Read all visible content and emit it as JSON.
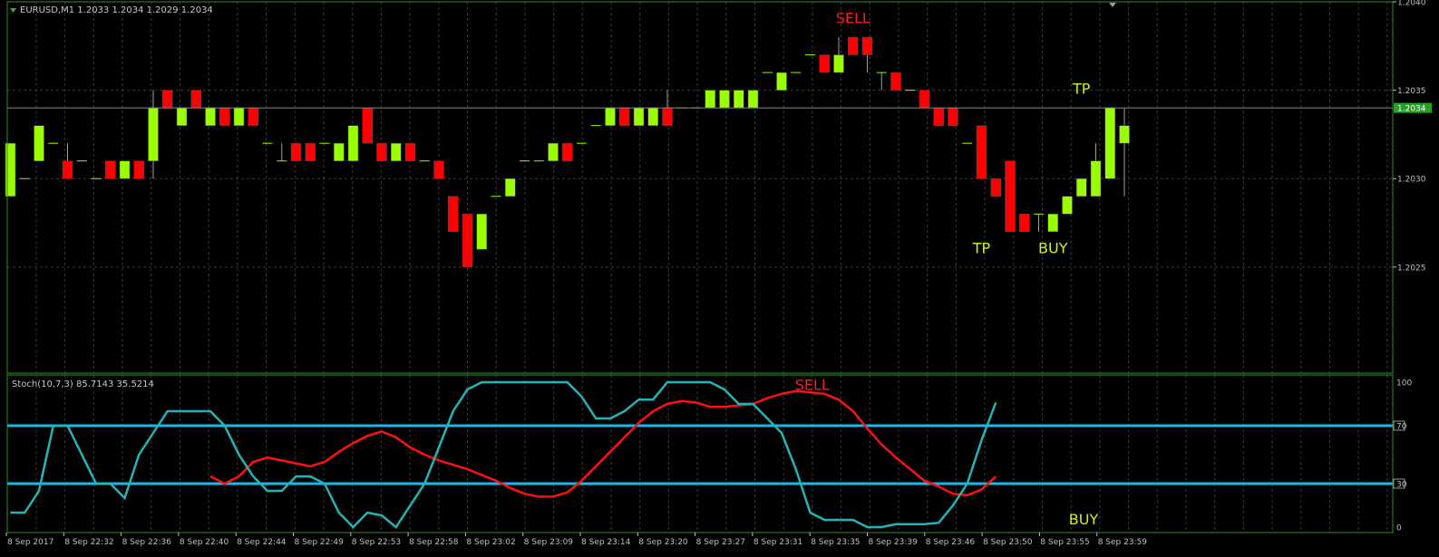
{
  "main_panel": {
    "header": "EURUSD,M1  1.2033 1.2034 1.2029 1.2034",
    "last_price_label": "1.2034",
    "ylim": [
      1.2019,
      1.204
    ],
    "y_ticks": [
      "1.2040",
      "1.2035",
      "1.2030",
      "1.2025"
    ],
    "y_tick_values": [
      1.204,
      1.2035,
      1.203,
      1.2025
    ],
    "last_price": 1.2034,
    "signals": [
      {
        "text": "SELL",
        "bar": 59,
        "price": 1.20386,
        "color": "#ff1a1a",
        "anchor": "above"
      },
      {
        "text": "TP",
        "bar": 68,
        "price": 1.20265,
        "color": "#c8f514",
        "anchor": "below"
      },
      {
        "text": "BUY",
        "bar": 73,
        "price": 1.20265,
        "color": "#c8f514",
        "anchor": "below"
      },
      {
        "text": "TP",
        "bar": 75,
        "price": 1.20346,
        "color": "#c8f514",
        "anchor": "above"
      }
    ]
  },
  "stoch_panel": {
    "header": "Stoch(10,7,3) 85.7143 35.5214",
    "ylim": [
      0,
      100
    ],
    "y_ticks": [
      "100",
      "70",
      "30",
      "0"
    ],
    "y_tick_values": [
      100,
      70,
      30,
      0
    ],
    "levels": [
      70,
      30
    ],
    "signals": [
      {
        "text": "SELL",
        "bar": 55,
        "value": 96,
        "color": "#ff1a1a"
      },
      {
        "text": "BUY",
        "bar": 74,
        "value": 3,
        "color": "#c8f514"
      }
    ]
  },
  "x_labels": [
    "8 Sep 2017",
    "8 Sep 22:32",
    "8 Sep 22:36",
    "8 Sep 22:40",
    "8 Sep 22:44",
    "8 Sep 22:49",
    "8 Sep 22:53",
    "8 Sep 22:58",
    "8 Sep 23:02",
    "8 Sep 23:09",
    "8 Sep 23:14",
    "8 Sep 23:20",
    "8 Sep 23:27",
    "8 Sep 23:31",
    "8 Sep 23:35",
    "8 Sep 23:39",
    "8 Sep 23:46",
    "8 Sep 23:50",
    "8 Sep 23:55",
    "8 Sep 23:59"
  ],
  "colors": {
    "background": "#000000",
    "grid": "#3a3a3a",
    "frame": "#2f8f2f",
    "axis_text": "#c0c0c0",
    "bull": "#99ff00",
    "bear": "#ff0000",
    "level_line": "#18b8ea",
    "stoch_main": "#23b5b5",
    "stoch_signal": "#ff0000",
    "price_badge_bg": "#24a024"
  },
  "chart_data": {
    "type": "candlestick",
    "symbol": "EURUSD",
    "timeframe": "M1",
    "candles": [
      {
        "o": 1.2029,
        "h": 1.2032,
        "l": 1.2029,
        "c": 1.2032
      },
      {
        "o": 1.203,
        "h": 1.203,
        "l": 1.203,
        "c": 1.203
      },
      {
        "o": 1.2031,
        "h": 1.2033,
        "l": 1.2031,
        "c": 1.2033
      },
      {
        "o": 1.2032,
        "h": 1.2032,
        "l": 1.2032,
        "c": 1.2032
      },
      {
        "o": 1.2031,
        "h": 1.2032,
        "l": 1.203,
        "c": 1.203
      },
      {
        "o": 1.2031,
        "h": 1.2031,
        "l": 1.2031,
        "c": 1.2031
      },
      {
        "o": 1.203,
        "h": 1.203,
        "l": 1.203,
        "c": 1.203
      },
      {
        "o": 1.2031,
        "h": 1.2031,
        "l": 1.203,
        "c": 1.203
      },
      {
        "o": 1.203,
        "h": 1.2031,
        "l": 1.203,
        "c": 1.2031
      },
      {
        "o": 1.2031,
        "h": 1.2031,
        "l": 1.203,
        "c": 1.203
      },
      {
        "o": 1.2031,
        "h": 1.2035,
        "l": 1.203,
        "c": 1.2034
      },
      {
        "o": 1.2035,
        "h": 1.2035,
        "l": 1.2034,
        "c": 1.2034
      },
      {
        "o": 1.2033,
        "h": 1.2034,
        "l": 1.2033,
        "c": 1.2034
      },
      {
        "o": 1.2035,
        "h": 1.2035,
        "l": 1.2034,
        "c": 1.2034
      },
      {
        "o": 1.2033,
        "h": 1.2034,
        "l": 1.2033,
        "c": 1.2034
      },
      {
        "o": 1.2034,
        "h": 1.2034,
        "l": 1.2033,
        "c": 1.2033
      },
      {
        "o": 1.2033,
        "h": 1.2034,
        "l": 1.2033,
        "c": 1.2034
      },
      {
        "o": 1.2034,
        "h": 1.2034,
        "l": 1.2033,
        "c": 1.2033
      },
      {
        "o": 1.2032,
        "h": 1.2032,
        "l": 1.2032,
        "c": 1.2032
      },
      {
        "o": 1.2031,
        "h": 1.2032,
        "l": 1.2031,
        "c": 1.2031
      },
      {
        "o": 1.2032,
        "h": 1.2032,
        "l": 1.2031,
        "c": 1.2031
      },
      {
        "o": 1.2032,
        "h": 1.2032,
        "l": 1.2031,
        "c": 1.2031
      },
      {
        "o": 1.2032,
        "h": 1.2032,
        "l": 1.2032,
        "c": 1.2032
      },
      {
        "o": 1.2031,
        "h": 1.2032,
        "l": 1.2031,
        "c": 1.2032
      },
      {
        "o": 1.2031,
        "h": 1.2033,
        "l": 1.2031,
        "c": 1.2033
      },
      {
        "o": 1.2034,
        "h": 1.2034,
        "l": 1.2032,
        "c": 1.2032
      },
      {
        "o": 1.2032,
        "h": 1.2032,
        "l": 1.2031,
        "c": 1.2031
      },
      {
        "o": 1.2031,
        "h": 1.2032,
        "l": 1.2031,
        "c": 1.2032
      },
      {
        "o": 1.2032,
        "h": 1.2032,
        "l": 1.2031,
        "c": 1.2031
      },
      {
        "o": 1.2031,
        "h": 1.2031,
        "l": 1.2031,
        "c": 1.2031
      },
      {
        "o": 1.2031,
        "h": 1.2031,
        "l": 1.203,
        "c": 1.203
      },
      {
        "o": 1.2029,
        "h": 1.2029,
        "l": 1.2027,
        "c": 1.2027
      },
      {
        "o": 1.2028,
        "h": 1.2028,
        "l": 1.2025,
        "c": 1.2025
      },
      {
        "o": 1.2026,
        "h": 1.2028,
        "l": 1.2026,
        "c": 1.2028
      },
      {
        "o": 1.2029,
        "h": 1.2029,
        "l": 1.2029,
        "c": 1.2029
      },
      {
        "o": 1.2029,
        "h": 1.203,
        "l": 1.2029,
        "c": 1.203
      },
      {
        "o": 1.2031,
        "h": 1.2031,
        "l": 1.2031,
        "c": 1.2031
      },
      {
        "o": 1.2031,
        "h": 1.2031,
        "l": 1.2031,
        "c": 1.2031
      },
      {
        "o": 1.2031,
        "h": 1.2032,
        "l": 1.2031,
        "c": 1.2032
      },
      {
        "o": 1.2032,
        "h": 1.2032,
        "l": 1.2031,
        "c": 1.2031
      },
      {
        "o": 1.2032,
        "h": 1.2032,
        "l": 1.2032,
        "c": 1.2032
      },
      {
        "o": 1.2033,
        "h": 1.2033,
        "l": 1.2033,
        "c": 1.2033
      },
      {
        "o": 1.2033,
        "h": 1.2034,
        "l": 1.2033,
        "c": 1.2034
      },
      {
        "o": 1.2034,
        "h": 1.2034,
        "l": 1.2033,
        "c": 1.2033
      },
      {
        "o": 1.2033,
        "h": 1.2034,
        "l": 1.2033,
        "c": 1.2034
      },
      {
        "o": 1.2033,
        "h": 1.2034,
        "l": 1.2033,
        "c": 1.2034
      },
      {
        "o": 1.2034,
        "h": 1.2035,
        "l": 1.2033,
        "c": 1.2033
      },
      {
        "o": 1.2034,
        "h": 1.2034,
        "l": 1.2034,
        "c": 1.2034
      },
      {
        "o": 1.2034,
        "h": 1.2034,
        "l": 1.2034,
        "c": 1.2034
      },
      {
        "o": 1.2034,
        "h": 1.2035,
        "l": 1.2034,
        "c": 1.2035
      },
      {
        "o": 1.2034,
        "h": 1.2035,
        "l": 1.2034,
        "c": 1.2035
      },
      {
        "o": 1.2034,
        "h": 1.2035,
        "l": 1.2034,
        "c": 1.2035
      },
      {
        "o": 1.2034,
        "h": 1.2035,
        "l": 1.2034,
        "c": 1.2035
      },
      {
        "o": 1.2036,
        "h": 1.2036,
        "l": 1.2036,
        "c": 1.2036
      },
      {
        "o": 1.2035,
        "h": 1.2036,
        "l": 1.2035,
        "c": 1.2036
      },
      {
        "o": 1.2036,
        "h": 1.2036,
        "l": 1.2036,
        "c": 1.2036
      },
      {
        "o": 1.2037,
        "h": 1.2037,
        "l": 1.2037,
        "c": 1.2037
      },
      {
        "o": 1.2037,
        "h": 1.2037,
        "l": 1.2036,
        "c": 1.2036
      },
      {
        "o": 1.2036,
        "h": 1.2038,
        "l": 1.2036,
        "c": 1.2037
      },
      {
        "o": 1.2038,
        "h": 1.2038,
        "l": 1.2037,
        "c": 1.2037
      },
      {
        "o": 1.2038,
        "h": 1.2038,
        "l": 1.2036,
        "c": 1.2037
      },
      {
        "o": 1.2036,
        "h": 1.2036,
        "l": 1.2035,
        "c": 1.2036
      },
      {
        "o": 1.2036,
        "h": 1.2036,
        "l": 1.2035,
        "c": 1.2035
      },
      {
        "o": 1.2035,
        "h": 1.2035,
        "l": 1.2035,
        "c": 1.2035
      },
      {
        "o": 1.2035,
        "h": 1.2035,
        "l": 1.2034,
        "c": 1.2034
      },
      {
        "o": 1.2034,
        "h": 1.2034,
        "l": 1.2033,
        "c": 1.2033
      },
      {
        "o": 1.2034,
        "h": 1.2034,
        "l": 1.2033,
        "c": 1.2033
      },
      {
        "o": 1.2032,
        "h": 1.2032,
        "l": 1.2032,
        "c": 1.2032
      },
      {
        "o": 1.2033,
        "h": 1.2033,
        "l": 1.203,
        "c": 1.203
      },
      {
        "o": 1.203,
        "h": 1.203,
        "l": 1.2029,
        "c": 1.2029
      },
      {
        "o": 1.2031,
        "h": 1.2031,
        "l": 1.2027,
        "c": 1.2027
      },
      {
        "o": 1.2028,
        "h": 1.2028,
        "l": 1.2027,
        "c": 1.2027
      },
      {
        "o": 1.2028,
        "h": 1.2028,
        "l": 1.2027,
        "c": 1.2028
      },
      {
        "o": 1.2027,
        "h": 1.2028,
        "l": 1.2027,
        "c": 1.2028
      },
      {
        "o": 1.2028,
        "h": 1.2029,
        "l": 1.2028,
        "c": 1.2029
      },
      {
        "o": 1.2029,
        "h": 1.203,
        "l": 1.2029,
        "c": 1.203
      },
      {
        "o": 1.2029,
        "h": 1.2032,
        "l": 1.2029,
        "c": 1.2031
      },
      {
        "o": 1.203,
        "h": 1.2034,
        "l": 1.203,
        "c": 1.2034
      },
      {
        "o": 1.2032,
        "h": 1.2034,
        "l": 1.2029,
        "c": 1.2033
      }
    ],
    "stochastic": {
      "name": "Stoch(10,7,3)",
      "main": [
        10,
        10,
        25,
        70,
        70,
        50,
        30,
        30,
        20,
        50,
        65,
        80,
        80,
        80,
        80,
        70,
        50,
        35,
        25,
        25,
        35,
        35,
        30,
        10,
        0,
        10,
        8,
        0,
        15,
        30,
        55,
        80,
        95,
        100,
        100,
        100,
        100,
        100,
        100,
        100,
        90,
        75,
        75,
        80,
        88,
        88,
        100,
        100,
        100,
        100,
        95,
        85,
        85,
        75,
        65,
        40,
        10,
        5,
        5,
        5,
        0,
        0,
        2,
        2,
        2,
        3,
        15,
        30,
        60,
        86
      ],
      "signal": [
        35,
        30,
        35,
        45,
        48,
        46,
        44,
        42,
        45,
        52,
        58,
        63,
        66,
        62,
        55,
        50,
        46,
        43,
        40,
        36,
        32,
        27,
        23,
        21,
        21,
        24,
        32,
        42,
        52,
        62,
        72,
        80,
        85,
        87,
        86,
        83,
        83,
        84,
        85,
        89,
        92,
        94,
        93,
        92,
        88,
        80,
        68,
        57,
        48,
        40,
        32,
        28,
        23,
        22,
        26,
        35
      ]
    },
    "levels": [
      70,
      30
    ],
    "ylim": [
      1.2019,
      1.204
    ],
    "stoch_ylim": [
      0,
      100
    ]
  }
}
